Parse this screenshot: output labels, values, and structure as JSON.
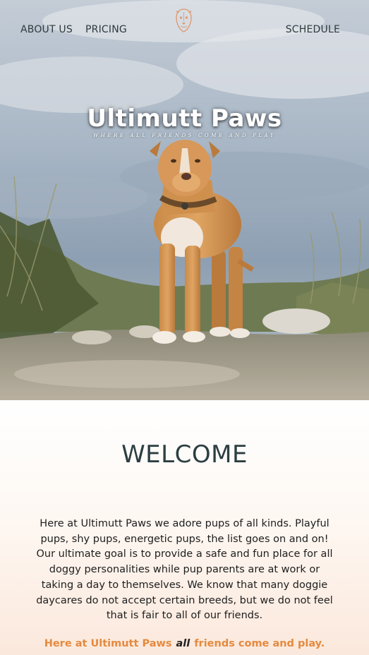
{
  "nav": {
    "about": "ABOUT US",
    "pricing": "PRICING",
    "schedule": "SCHEDULE"
  },
  "hero": {
    "title": "Ultimutt Paws",
    "tagline": "WHERE ALL FRIENDS COME AND PLAY"
  },
  "welcome": {
    "heading": "WELCOME",
    "body": "Here at Ultimutt Paws we adore pups of all kinds. Playful pups, shy pups, energetic pups, the list goes on and on! Our ultimate goal is to provide a safe and fun place for all doggy personalities while pup parents are at work or taking a day to themselves. We know that many doggie daycares do not accept certain breeds, but we do not feel that is fair to all of our friends.",
    "tag_before": "Here at Ultimutt Paws",
    "tag_emph": "all",
    "tag_after": "friends come and play."
  },
  "colors": {
    "accent": "#e58a3f",
    "heading": "#2c3e42",
    "nav_text": "#2f3a3c"
  },
  "icons": {
    "logo": "dog-face-logo-icon"
  }
}
